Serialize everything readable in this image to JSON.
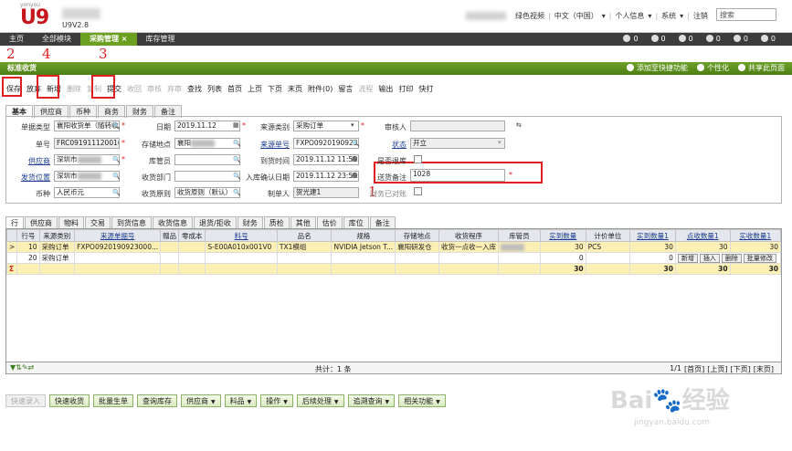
{
  "header": {
    "brand_small": "yonyou",
    "logo": "U9",
    "version": "U9V2.8",
    "links": [
      "绿色视频",
      "中文（中国）",
      "个人信息",
      "系统",
      "注销"
    ],
    "search_placeholder": "搜索"
  },
  "nav": {
    "tabs": [
      "主页",
      "全部模块",
      "采购管理 ×",
      "库存管理"
    ],
    "counters": [
      "0",
      "0",
      "0",
      "0",
      "0",
      "0"
    ]
  },
  "page": {
    "title": "标准收货",
    "actions": [
      "添加至快捷功能",
      "个性化",
      "共享此页面"
    ]
  },
  "toolbar": {
    "items": [
      "保存",
      "放弃",
      "新增",
      "删除",
      "复制",
      "提交",
      "收回",
      "审核",
      "弃审",
      "查找",
      "列表",
      "首页",
      "上页",
      "下页",
      "末页",
      "附件(0)",
      "留言",
      "流程",
      "输出",
      "打印",
      "快打"
    ],
    "disabled": [
      false,
      false,
      false,
      true,
      true,
      false,
      true,
      true,
      true,
      false,
      false,
      false,
      false,
      false,
      false,
      false,
      false,
      true,
      false,
      false,
      false
    ]
  },
  "annotations": [
    "2",
    "4",
    "3",
    "1"
  ],
  "form_tabs": [
    "基本",
    "供应商",
    "币种",
    "商务",
    "财务",
    "备注"
  ],
  "form": {
    "doc_type_label": "单据类型",
    "doc_type": "襄阳收货单（随转收",
    "doc_no_label": "单号",
    "doc_no": "FRC091911120016",
    "supplier_label": "供应商",
    "supplier": "深圳市",
    "ship_loc_label": "发货位置",
    "ship_loc": "深圳市",
    "currency_label": "币种",
    "currency": "人民币元",
    "date_label": "日期",
    "date": "2019.11.12",
    "storage_label": "存储地点",
    "storage": "襄阳",
    "warehouse_clerk_label": "库管员",
    "warehouse_clerk": "",
    "recv_dept_label": "收货部门",
    "recv_dept": "",
    "recv_principle_label": "收货原则",
    "recv_principle": "收货原则（默认）",
    "source_type_label": "来源类别",
    "source_type": "采购订单",
    "source_no_label": "来源单号",
    "source_no": "FXPO09201909230002",
    "arrival_time_label": "到货时间",
    "arrival_time": "2019.11.12 11:59:06",
    "confirm_date_label": "入库确认日期",
    "confirm_date": "2019.11.12 23:59:00",
    "creator_label": "制单人",
    "creator": "贺光建1",
    "approver_label": "审核人",
    "approver": "",
    "status_label": "状态",
    "status": "开立",
    "returned_label": "是否退库",
    "delivery_note_label": "送货备注",
    "delivery_note": "1028",
    "finance_label": "财务已对账"
  },
  "line_tabs": [
    "行",
    "供应商",
    "物料",
    "交易",
    "到货信息",
    "收货信息",
    "退货/拒收",
    "财务",
    "质检",
    "其他",
    "估价",
    "库位",
    "备注"
  ],
  "grid": {
    "headers": [
      "行号",
      "来源类别",
      "来源单据号",
      "赠品",
      "零成本",
      "料号",
      "品名",
      "规格",
      "存储地点",
      "收货程序",
      "库管员",
      "实到数量",
      "计价单位",
      "实到数量1",
      "点收数量1",
      "实收数量1"
    ],
    "rows": [
      [
        "10",
        "采购订单",
        "FXPO0920190923000...",
        "",
        "",
        "S-E00A010x001V0",
        "TX1模组",
        "NVIDIA Jetson T...",
        "襄阳研发仓",
        "收货一点收一入库",
        "",
        "30",
        "PCS",
        "30",
        "30",
        "30"
      ],
      [
        "20",
        "采购订单",
        "",
        "",
        "",
        "",
        "",
        "",
        "",
        "",
        "",
        "0",
        "",
        "0",
        "新增",
        "插入"
      ]
    ],
    "row_buttons": [
      "新增",
      "插入",
      "删除",
      "批量修改"
    ],
    "totals": [
      "30",
      "30",
      "30",
      "30"
    ],
    "footer_total": "共计：1 条",
    "pager": [
      "1/1",
      "[首页]",
      "[上页]",
      "[下页]",
      "[末页]"
    ]
  },
  "bottom_buttons": [
    "快速录入",
    "快速收货",
    "批量生单",
    "查询库存",
    "供应商",
    "料品",
    "操作",
    "后续处理",
    "追溯查询",
    "相关功能"
  ],
  "watermark": [
    "Bai",
    "经验",
    "jingyan.baidu.com"
  ]
}
